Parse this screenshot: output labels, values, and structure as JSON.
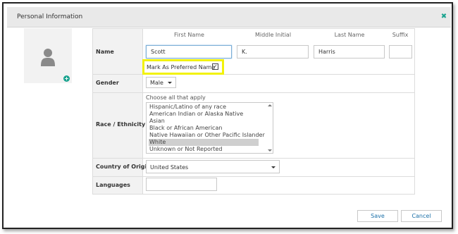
{
  "dialog": {
    "title": "Personal Information",
    "close_glyph": "✖"
  },
  "avatar": {
    "add_glyph": "+"
  },
  "form": {
    "name": {
      "label": "Name",
      "columns": [
        "First Name",
        "Middle Initial",
        "Last Name",
        "Suffix"
      ],
      "first": "Scott",
      "middle": "K.",
      "last": "Harris",
      "suffix": "",
      "preferred_label": "Mark As Preferred Name",
      "preferred_checked": "✓"
    },
    "gender": {
      "label": "Gender",
      "value": "Male"
    },
    "race": {
      "label": "Race / Ethnicity",
      "hint": "Choose all that apply",
      "options": [
        "Hispanic/Latino of any race",
        "American Indian or Alaska Native",
        "Asian",
        "Black or African American",
        "Native Hawaiian or Other Pacific Islander",
        "White",
        "Unknown or Not Reported"
      ],
      "selected": "White"
    },
    "country": {
      "label": "Country of Origin",
      "value": "United States"
    },
    "languages": {
      "label": "Languages",
      "value": ""
    }
  },
  "footer": {
    "save_label": "Save",
    "cancel_label": "Cancel"
  },
  "colors": {
    "accent": "#1aa38f",
    "highlight": "#f2f20a",
    "link": "#1a6fa8"
  }
}
